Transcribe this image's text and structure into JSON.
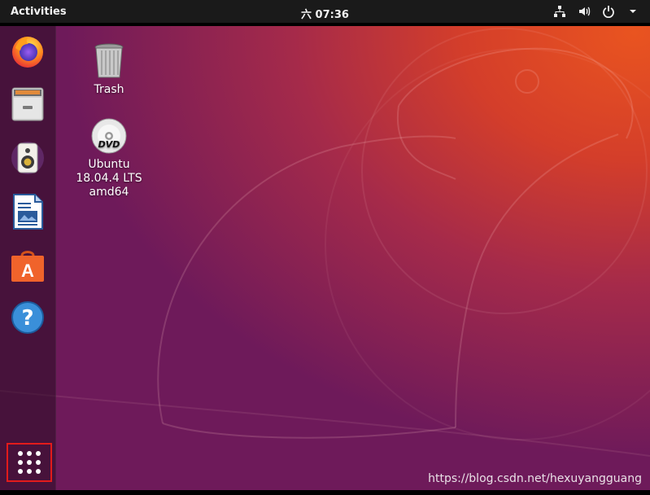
{
  "topbar": {
    "activities_label": "Activities",
    "clock_text": "六 07:36",
    "tray_icons": [
      "network-icon",
      "volume-icon",
      "power-icon",
      "chevron-down-icon"
    ]
  },
  "dock": {
    "items": [
      {
        "name": "Firefox",
        "icon": "firefox-icon"
      },
      {
        "name": "Files",
        "icon": "file-cabinet-icon"
      },
      {
        "name": "Rhythmbox",
        "icon": "speaker-icon"
      },
      {
        "name": "LibreOffice Writer",
        "icon": "writer-document-icon"
      },
      {
        "name": "Ubuntu Software",
        "icon": "shopping-bag-icon"
      },
      {
        "name": "Help",
        "icon": "help-icon"
      }
    ],
    "show_apps_icon": "grid-dots-icon"
  },
  "desktop_icons": [
    {
      "label": "Trash",
      "icon": "trash-icon"
    },
    {
      "label_lines": [
        "Ubuntu",
        "18.04.4 LTS",
        "amd64"
      ],
      "icon": "dvd-icon"
    }
  ],
  "watermark": "https://blog.csdn.net/hexuyangguang",
  "colors": {
    "accent": "#e95420",
    "topbar": "#1a1a1a",
    "highlight_border": "#e21b1b"
  }
}
